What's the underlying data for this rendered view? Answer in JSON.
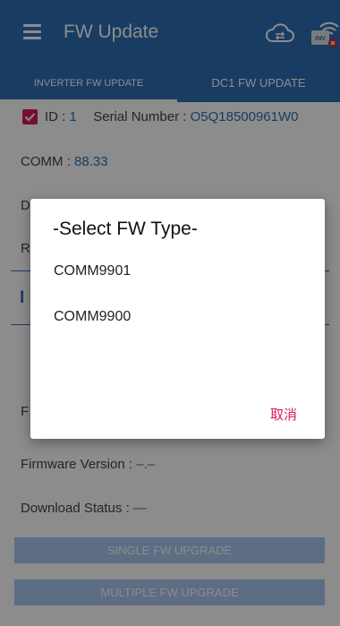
{
  "appbar": {
    "title": "FW Update",
    "menu_icon": "hamburger-menu-icon",
    "cloud_icon": "cloud-sync-icon",
    "inv_icon": "inverter-wifi-icon",
    "inv_badge": "INV"
  },
  "tabs": [
    {
      "label": "INVERTER FW UPDATE",
      "active": true
    },
    {
      "label": "DC1 FW UPDATE",
      "active": false
    }
  ],
  "device": {
    "id_label": "ID :",
    "id_value": "1",
    "serial_label": "Serial Number :",
    "serial_value": "O5Q18500961W0",
    "comm_label": "COMM :",
    "comm_value": "88.33",
    "row3_prefix": "D",
    "row4_prefix": "R",
    "section_prefix": "I",
    "row5_prefix": "F"
  },
  "firmware": {
    "version_label": "Firmware Version :",
    "version_value": "–.–",
    "download_label": "Download Status :",
    "download_value": "—"
  },
  "buttons": {
    "single": "SINGLE FW UPGRADE",
    "multiple": "MULTIPLE FW UPGRADE"
  },
  "dialog": {
    "title": "-Select FW Type-",
    "options": [
      "COMM9901",
      "COMM9900"
    ],
    "cancel": "取消"
  },
  "colors": {
    "primary": "#2f6db5",
    "accent": "#d81b60",
    "button": "#a8c7f0"
  }
}
